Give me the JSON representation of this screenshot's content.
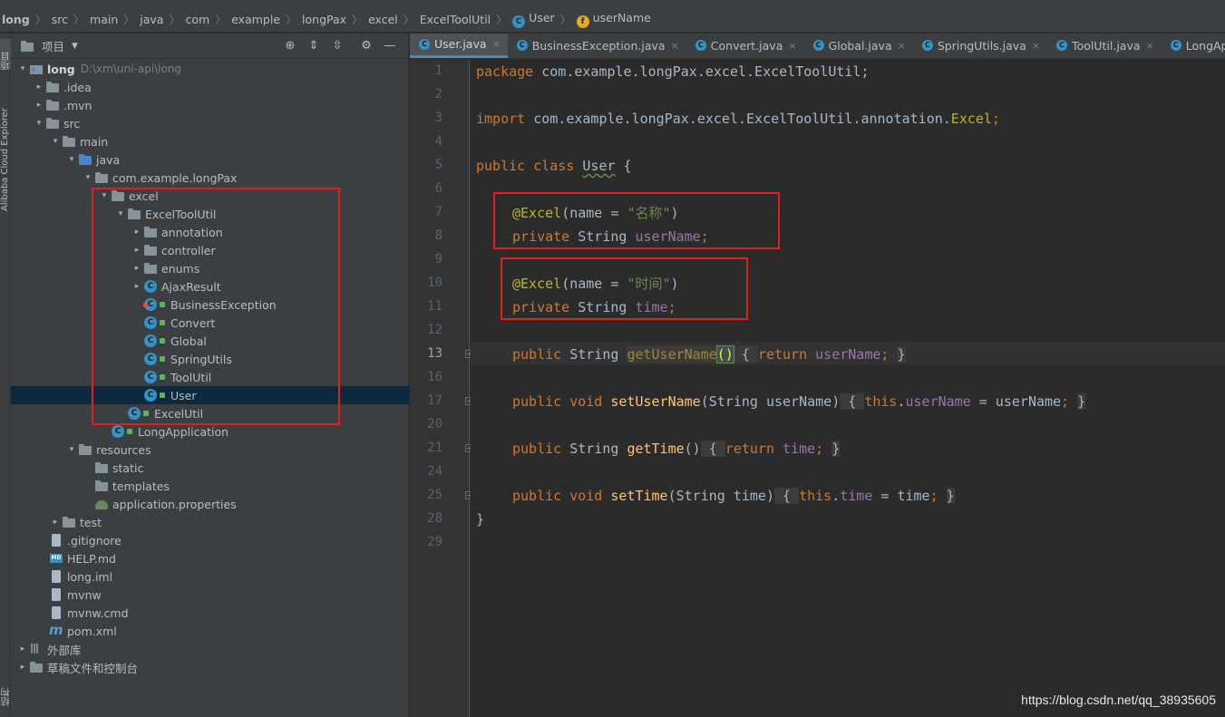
{
  "breadcrumb": [
    "long",
    "src",
    "main",
    "java",
    "com",
    "example",
    "longPax",
    "excel",
    "ExcelToolUtil",
    "User",
    "userName"
  ],
  "left_strip": {
    "top_label": "项目",
    "cloud_label": "Alibaba Cloud Explorer",
    "bottom_label": "结构"
  },
  "project_panel": {
    "title": "项目",
    "tools": [
      "target-icon",
      "expand-icon",
      "collapse-icon",
      "gear-icon",
      "minimize-icon"
    ],
    "tree": [
      {
        "label": "long",
        "sub": "D:\\xm\\uni-api\\long",
        "icon": "module-icon",
        "arrow": "▾",
        "bold": true
      },
      {
        "label": ".idea",
        "icon": "folder-icon",
        "arrow": "▸"
      },
      {
        "label": ".mvn",
        "icon": "folder-icon",
        "arrow": "▸"
      },
      {
        "label": "src",
        "icon": "folder-icon",
        "arrow": "▾"
      },
      {
        "label": "main",
        "icon": "folder-icon",
        "arrow": "▾"
      },
      {
        "label": "java",
        "icon": "source-folder-icon",
        "arrow": "▾"
      },
      {
        "label": "com.example.longPax",
        "icon": "package-icon",
        "arrow": "▾"
      },
      {
        "label": "excel",
        "icon": "package-icon",
        "arrow": "▾"
      },
      {
        "label": "ExcelToolUtil",
        "icon": "package-icon",
        "arrow": "▾"
      },
      {
        "label": "annotation",
        "icon": "package-icon",
        "arrow": "▸"
      },
      {
        "label": "controller",
        "icon": "package-icon",
        "arrow": "▸"
      },
      {
        "label": "enums",
        "icon": "package-icon",
        "arrow": "▸"
      },
      {
        "label": "AjaxResult",
        "icon": "class-icon",
        "arrow": "▸"
      },
      {
        "label": "BusinessException",
        "icon": "exception-class-icon",
        "arrow": ""
      },
      {
        "label": "Convert",
        "icon": "class-icon",
        "arrow": ""
      },
      {
        "label": "Global",
        "icon": "class-icon",
        "arrow": ""
      },
      {
        "label": "SpringUtils",
        "icon": "class-icon",
        "arrow": ""
      },
      {
        "label": "ToolUtil",
        "icon": "class-icon",
        "arrow": ""
      },
      {
        "label": "User",
        "icon": "class-icon",
        "arrow": "",
        "selected": true
      },
      {
        "label": "ExcelUtil",
        "icon": "class-icon",
        "arrow": ""
      },
      {
        "label": "LongApplication",
        "icon": "spring-boot-class-icon",
        "arrow": ""
      },
      {
        "label": "resources",
        "icon": "resources-folder-icon",
        "arrow": "▾"
      },
      {
        "label": "static",
        "icon": "folder-icon",
        "arrow": ""
      },
      {
        "label": "templates",
        "icon": "folder-icon",
        "arrow": ""
      },
      {
        "label": "application.properties",
        "icon": "properties-icon",
        "arrow": ""
      },
      {
        "label": "test",
        "icon": "folder-icon",
        "arrow": "▸"
      },
      {
        "label": ".gitignore",
        "icon": "file-icon",
        "arrow": ""
      },
      {
        "label": "HELP.md",
        "icon": "markdown-icon",
        "arrow": ""
      },
      {
        "label": "long.iml",
        "icon": "file-icon",
        "arrow": ""
      },
      {
        "label": "mvnw",
        "icon": "file-icon",
        "arrow": ""
      },
      {
        "label": "mvnw.cmd",
        "icon": "file-icon",
        "arrow": ""
      },
      {
        "label": "pom.xml",
        "icon": "maven-icon",
        "arrow": ""
      },
      {
        "label": "外部库",
        "icon": "library-icon",
        "arrow": "▸"
      },
      {
        "label": "草稿文件和控制台",
        "icon": "scratch-icon",
        "arrow": "▸"
      }
    ]
  },
  "tabs": [
    {
      "label": "User.java",
      "active": true
    },
    {
      "label": "BusinessException.java"
    },
    {
      "label": "Convert.java"
    },
    {
      "label": "Global.java"
    },
    {
      "label": "SpringUtils.java"
    },
    {
      "label": "ToolUtil.java"
    },
    {
      "label": "LongApplication"
    }
  ],
  "editor": {
    "line_numbers": [
      "1",
      "2",
      "3",
      "4",
      "5",
      "6",
      "7",
      "8",
      "9",
      "10",
      "11",
      "12",
      "13",
      "16",
      "17",
      "20",
      "21",
      "24",
      "25",
      "28",
      "29"
    ],
    "current_line": "13",
    "code": {
      "l1_kw": "package",
      "l1_rest": " com.example.longPax.excel.ExcelToolUtil;",
      "l3_kw": "import",
      "l3_mid": " com.example.longPax.excel.ExcelToolUtil.annotation.",
      "l3_ann": "Excel",
      "l3_end": ";",
      "l5_kw": "public class",
      "l5_cls": "User",
      "l5_end": " {",
      "l7_ann": "@Excel",
      "l7_a": "(name = ",
      "l7_str": "\"名称\"",
      "l7_b": ")",
      "l8_kw": "private",
      "l8_type": " String ",
      "l8_fld": "userName",
      "l8_end": ";",
      "l10_ann": "@Excel",
      "l10_a": "(name = ",
      "l10_str": "\"时间\"",
      "l10_b": ")",
      "l11_kw": "private",
      "l11_type": " String ",
      "l11_fld": "time",
      "l11_end": ";",
      "l13_kw": "public",
      "l13_type": " String ",
      "l13_mth": "getUserName",
      "l13_paren": "()",
      "l13_o": " { ",
      "l13_ret": "return",
      "l13_fld": " userName",
      "l13_semi": "; ",
      "l13_c": "}",
      "l17_kw": "public void",
      "l17_mth": "setUserName",
      "l17_args": "(String userName)",
      "l17_o": " { ",
      "l17_this": "this",
      "l17_dot": ".",
      "l17_fld": "userName",
      "l17_asg": " = userName",
      "l17_semi": "; ",
      "l17_c": "}",
      "l21_kw": "public",
      "l21_type": " String ",
      "l21_mth": "getTime",
      "l21_paren": "()",
      "l21_o": " { ",
      "l21_ret": "return",
      "l21_fld": " time",
      "l21_semi": "; ",
      "l21_c": "}",
      "l25_kw": "public void",
      "l25_mth": "setTime",
      "l25_args": "(String time)",
      "l25_o": " { ",
      "l25_this": "this",
      "l25_dot": ".",
      "l25_fld": "time",
      "l25_asg": " = time",
      "l25_semi": "; ",
      "l25_c": "}",
      "l28": "}"
    }
  },
  "watermark": "https://blog.csdn.net/qq_38935605",
  "colors": {
    "highlight_box": "#e02020",
    "selection": "#0d293e",
    "accent": "#4a88c7"
  }
}
